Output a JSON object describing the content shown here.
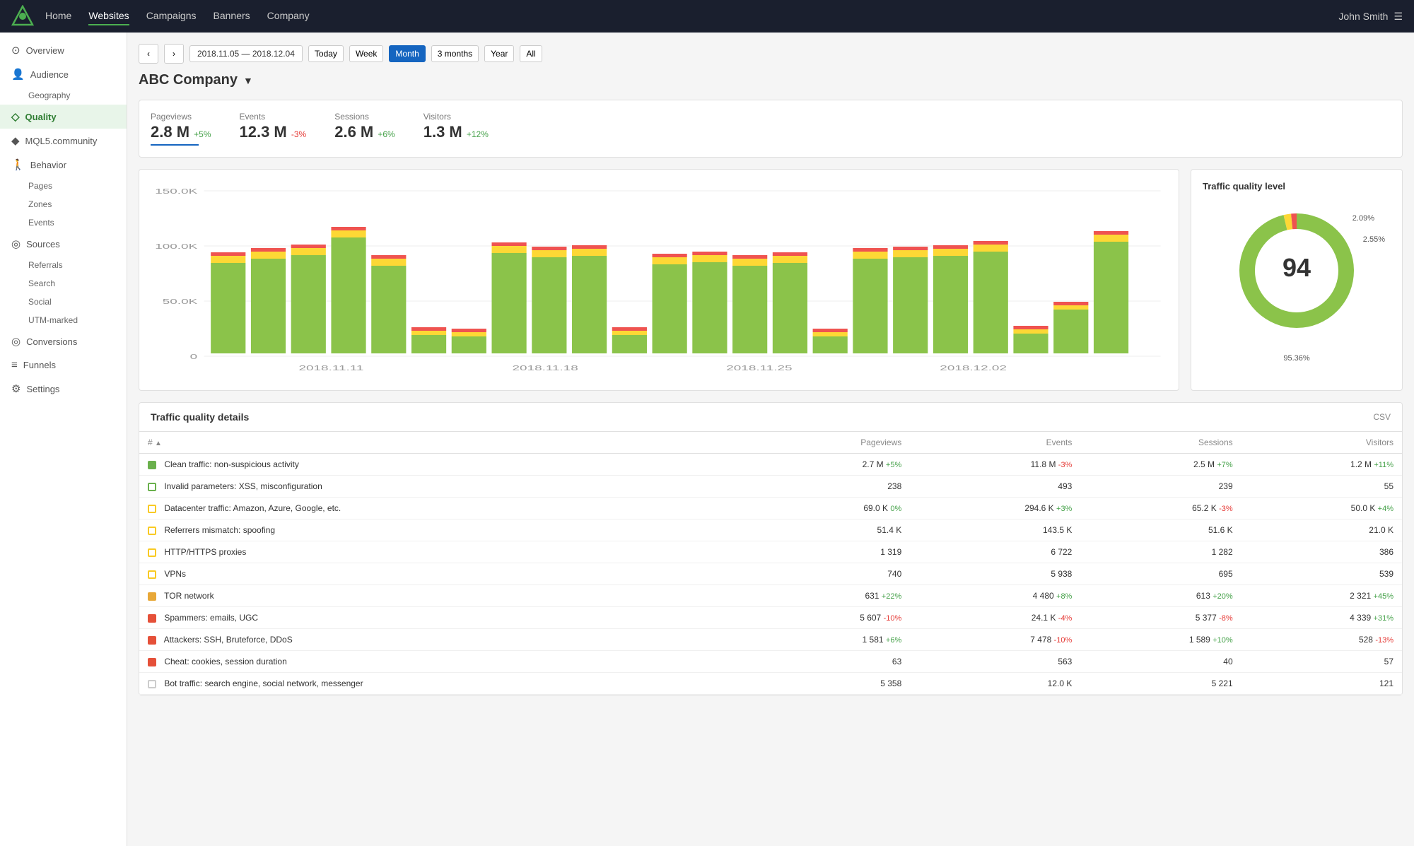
{
  "topnav": {
    "items": [
      {
        "label": "Home",
        "active": false
      },
      {
        "label": "Websites",
        "active": true
      },
      {
        "label": "Campaigns",
        "active": false
      },
      {
        "label": "Banners",
        "active": false
      },
      {
        "label": "Company",
        "active": false
      }
    ],
    "user": "John Smith"
  },
  "sidebar": {
    "items": [
      {
        "label": "Overview",
        "icon": "⊙",
        "active": false,
        "indent": 0
      },
      {
        "label": "Audience",
        "icon": "👤",
        "active": false,
        "indent": 0
      },
      {
        "label": "Geography",
        "icon": "",
        "active": false,
        "indent": 1
      },
      {
        "label": "Quality",
        "icon": "◇",
        "active": true,
        "indent": 0
      },
      {
        "label": "MQL5.community",
        "icon": "◆",
        "active": false,
        "indent": 0
      },
      {
        "label": "Behavior",
        "icon": "🚶",
        "active": false,
        "indent": 0
      },
      {
        "label": "Pages",
        "icon": "",
        "active": false,
        "indent": 1
      },
      {
        "label": "Zones",
        "icon": "",
        "active": false,
        "indent": 1
      },
      {
        "label": "Events",
        "icon": "",
        "active": false,
        "indent": 1
      },
      {
        "label": "Sources",
        "icon": "◎",
        "active": false,
        "indent": 0
      },
      {
        "label": "Referrals",
        "icon": "",
        "active": false,
        "indent": 1
      },
      {
        "label": "Search",
        "icon": "",
        "active": false,
        "indent": 1
      },
      {
        "label": "Social",
        "icon": "",
        "active": false,
        "indent": 1
      },
      {
        "label": "UTM-marked",
        "icon": "",
        "active": false,
        "indent": 1
      },
      {
        "label": "Conversions",
        "icon": "◎",
        "active": false,
        "indent": 0
      },
      {
        "label": "Funnels",
        "icon": "≡",
        "active": false,
        "indent": 0
      },
      {
        "label": "Settings",
        "icon": "⚙",
        "active": false,
        "indent": 0
      }
    ]
  },
  "datebar": {
    "range": "2018.11.05 — 2018.12.04",
    "buttons": [
      "Today",
      "Week",
      "Month",
      "3 months",
      "Year",
      "All"
    ],
    "active": "Month"
  },
  "company": "ABC Company",
  "metrics": [
    {
      "label": "Pageviews",
      "value": "2.8 M",
      "change": "+5%",
      "positive": true
    },
    {
      "label": "Events",
      "value": "12.3 M",
      "change": "-3%",
      "positive": false
    },
    {
      "label": "Sessions",
      "value": "2.6 M",
      "change": "+6%",
      "positive": true
    },
    {
      "label": "Visitors",
      "value": "1.3 M",
      "change": "+12%",
      "positive": true
    }
  ],
  "barchart": {
    "y_labels": [
      "150.0K",
      "100.0K",
      "50.0K",
      "0"
    ],
    "x_labels": [
      "2018.11.11",
      "2018.11.18",
      "2018.11.25",
      "2018.12.02"
    ],
    "bars": [
      {
        "h_green": 75,
        "h_yellow": 5,
        "h_red": 3
      },
      {
        "h_green": 80,
        "h_yellow": 6,
        "h_red": 3
      },
      {
        "h_green": 85,
        "h_yellow": 5,
        "h_red": 3
      },
      {
        "h_green": 100,
        "h_yellow": 7,
        "h_red": 4
      },
      {
        "h_green": 70,
        "h_yellow": 5,
        "h_red": 2
      },
      {
        "h_green": 25,
        "h_yellow": 3,
        "h_red": 2
      },
      {
        "h_green": 24,
        "h_yellow": 3,
        "h_red": 2
      },
      {
        "h_green": 82,
        "h_yellow": 6,
        "h_red": 3
      },
      {
        "h_green": 87,
        "h_yellow": 6,
        "h_red": 3
      },
      {
        "h_green": 88,
        "h_yellow": 6,
        "h_red": 3
      },
      {
        "h_green": 25,
        "h_yellow": 3,
        "h_red": 2
      },
      {
        "h_green": 76,
        "h_yellow": 5,
        "h_red": 3
      },
      {
        "h_green": 78,
        "h_yellow": 5,
        "h_red": 3
      },
      {
        "h_green": 72,
        "h_yellow": 5,
        "h_red": 3
      },
      {
        "h_green": 77,
        "h_yellow": 5,
        "h_red": 3
      },
      {
        "h_green": 25,
        "h_yellow": 3,
        "h_red": 2
      },
      {
        "h_green": 80,
        "h_yellow": 6,
        "h_red": 3
      },
      {
        "h_green": 82,
        "h_yellow": 6,
        "h_red": 3
      },
      {
        "h_green": 84,
        "h_yellow": 6,
        "h_red": 3
      },
      {
        "h_green": 85,
        "h_yellow": 6,
        "h_red": 3
      },
      {
        "h_green": 25,
        "h_yellow": 3,
        "h_red": 2
      },
      {
        "h_green": 30,
        "h_yellow": 3,
        "h_red": 2
      },
      {
        "h_green": 92,
        "h_yellow": 6,
        "h_red": 3
      }
    ]
  },
  "donut": {
    "title": "Traffic quality level",
    "center_value": "94",
    "segments": [
      {
        "label": "95.36%",
        "color": "#6ab04c",
        "percent": 95.36,
        "position": "bottom"
      },
      {
        "label": "2.09%",
        "color": "#f9ca24",
        "percent": 2.09,
        "position": "top-right"
      },
      {
        "label": "2.55%",
        "color": "#e55039",
        "percent": 2.55,
        "position": "right"
      }
    ]
  },
  "details": {
    "title": "Traffic quality details",
    "csv_label": "CSV",
    "columns": [
      "#",
      "Pageviews",
      "Events",
      "Sessions",
      "Visitors"
    ],
    "rows": [
      {
        "color": "#6ab04c",
        "border": false,
        "label": "Clean traffic: non-suspicious activity",
        "pageviews": "2.7 M",
        "pageviews_change": "+5%",
        "pageviews_pos": true,
        "events": "11.8 M",
        "events_change": "-3%",
        "events_pos": false,
        "sessions": "2.5 M",
        "sessions_change": "+7%",
        "sessions_pos": true,
        "visitors": "1.2 M",
        "visitors_change": "+11%",
        "visitors_pos": true
      },
      {
        "color": "#6ab04c",
        "border": true,
        "label": "Invalid parameters: XSS, misconfiguration",
        "pageviews": "238",
        "pageviews_change": "",
        "events": "493",
        "events_change": "",
        "sessions": "239",
        "sessions_change": "",
        "visitors": "55",
        "visitors_change": ""
      },
      {
        "color": "#f9ca24",
        "border": true,
        "label": "Datacenter traffic: Amazon, Azure, Google, etc.",
        "pageviews": "69.0 K",
        "pageviews_change": "0%",
        "pageviews_pos": true,
        "events": "294.6 K",
        "events_change": "+3%",
        "events_pos": true,
        "sessions": "65.2 K",
        "sessions_change": "-3%",
        "sessions_pos": false,
        "visitors": "50.0 K",
        "visitors_change": "+4%",
        "visitors_pos": true
      },
      {
        "color": "#f9ca24",
        "border": true,
        "label": "Referrers mismatch: spoofing",
        "pageviews": "51.4 K",
        "pageviews_change": "",
        "events": "143.5 K",
        "events_change": "",
        "sessions": "51.6 K",
        "sessions_change": "",
        "visitors": "21.0 K",
        "visitors_change": ""
      },
      {
        "color": "#f9ca24",
        "border": true,
        "label": "HTTP/HTTPS proxies",
        "pageviews": "1 319",
        "pageviews_change": "",
        "events": "6 722",
        "events_change": "",
        "sessions": "1 282",
        "sessions_change": "",
        "visitors": "386",
        "visitors_change": ""
      },
      {
        "color": "#f9ca24",
        "border": true,
        "label": "VPNs",
        "pageviews": "740",
        "pageviews_change": "",
        "events": "5 938",
        "events_change": "",
        "sessions": "695",
        "sessions_change": "",
        "visitors": "539",
        "visitors_change": ""
      },
      {
        "color": "#e8a838",
        "border": false,
        "label": "TOR network",
        "pageviews": "631",
        "pageviews_change": "+22%",
        "pageviews_pos": true,
        "events": "4 480",
        "events_change": "+8%",
        "events_pos": true,
        "sessions": "613",
        "sessions_change": "+20%",
        "sessions_pos": true,
        "visitors": "2 321",
        "visitors_change": "+45%",
        "visitors_pos": true
      },
      {
        "color": "#e55039",
        "border": false,
        "label": "Spammers: emails, UGC",
        "pageviews": "5 607",
        "pageviews_change": "-10%",
        "pageviews_pos": false,
        "events": "24.1 K",
        "events_change": "-4%",
        "events_pos": false,
        "sessions": "5 377",
        "sessions_change": "-8%",
        "sessions_pos": false,
        "visitors": "4 339",
        "visitors_change": "+31%",
        "visitors_pos": true
      },
      {
        "color": "#e55039",
        "border": false,
        "label": "Attackers: SSH, Bruteforce, DDoS",
        "pageviews": "1 581",
        "pageviews_change": "+6%",
        "pageviews_pos": true,
        "events": "7 478",
        "events_change": "-10%",
        "events_pos": false,
        "sessions": "1 589",
        "sessions_change": "+10%",
        "sessions_pos": true,
        "visitors": "528",
        "visitors_change": "-13%",
        "visitors_pos": false
      },
      {
        "color": "#e55039",
        "border": false,
        "label": "Cheat: cookies, session duration",
        "pageviews": "63",
        "pageviews_change": "",
        "events": "563",
        "events_change": "",
        "sessions": "40",
        "sessions_change": "",
        "visitors": "57",
        "visitors_change": ""
      },
      {
        "color": "#ccc",
        "border": true,
        "label": "Bot traffic: search engine, social network, messenger",
        "pageviews": "5 358",
        "pageviews_change": "",
        "events": "12.0 K",
        "events_change": "",
        "sessions": "5 221",
        "sessions_change": "",
        "visitors": "121",
        "visitors_change": ""
      }
    ]
  }
}
